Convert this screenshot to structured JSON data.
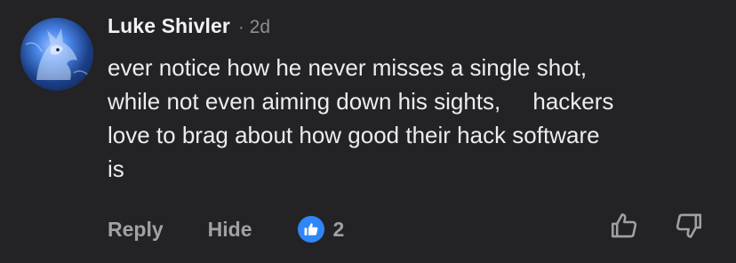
{
  "comment": {
    "author": "Luke Shivler",
    "separator": "·",
    "age": "2d",
    "text": "ever notice how he never misses a single shot,\nwhile not even aiming down his sights,     hackers\nlove to brag about how good their hack software\nis",
    "actions": {
      "reply_label": "Reply",
      "hide_label": "Hide"
    },
    "reactions": {
      "icon": "thumbs-up-icon",
      "count": "2"
    },
    "vote_icons": {
      "up": "thumbs-up-outline-icon",
      "down": "thumbs-down-outline-icon"
    }
  },
  "colors": {
    "background": "#232325",
    "text": "#ececee",
    "muted": "#a0a1a6",
    "like_blue": "#2f86f6"
  }
}
